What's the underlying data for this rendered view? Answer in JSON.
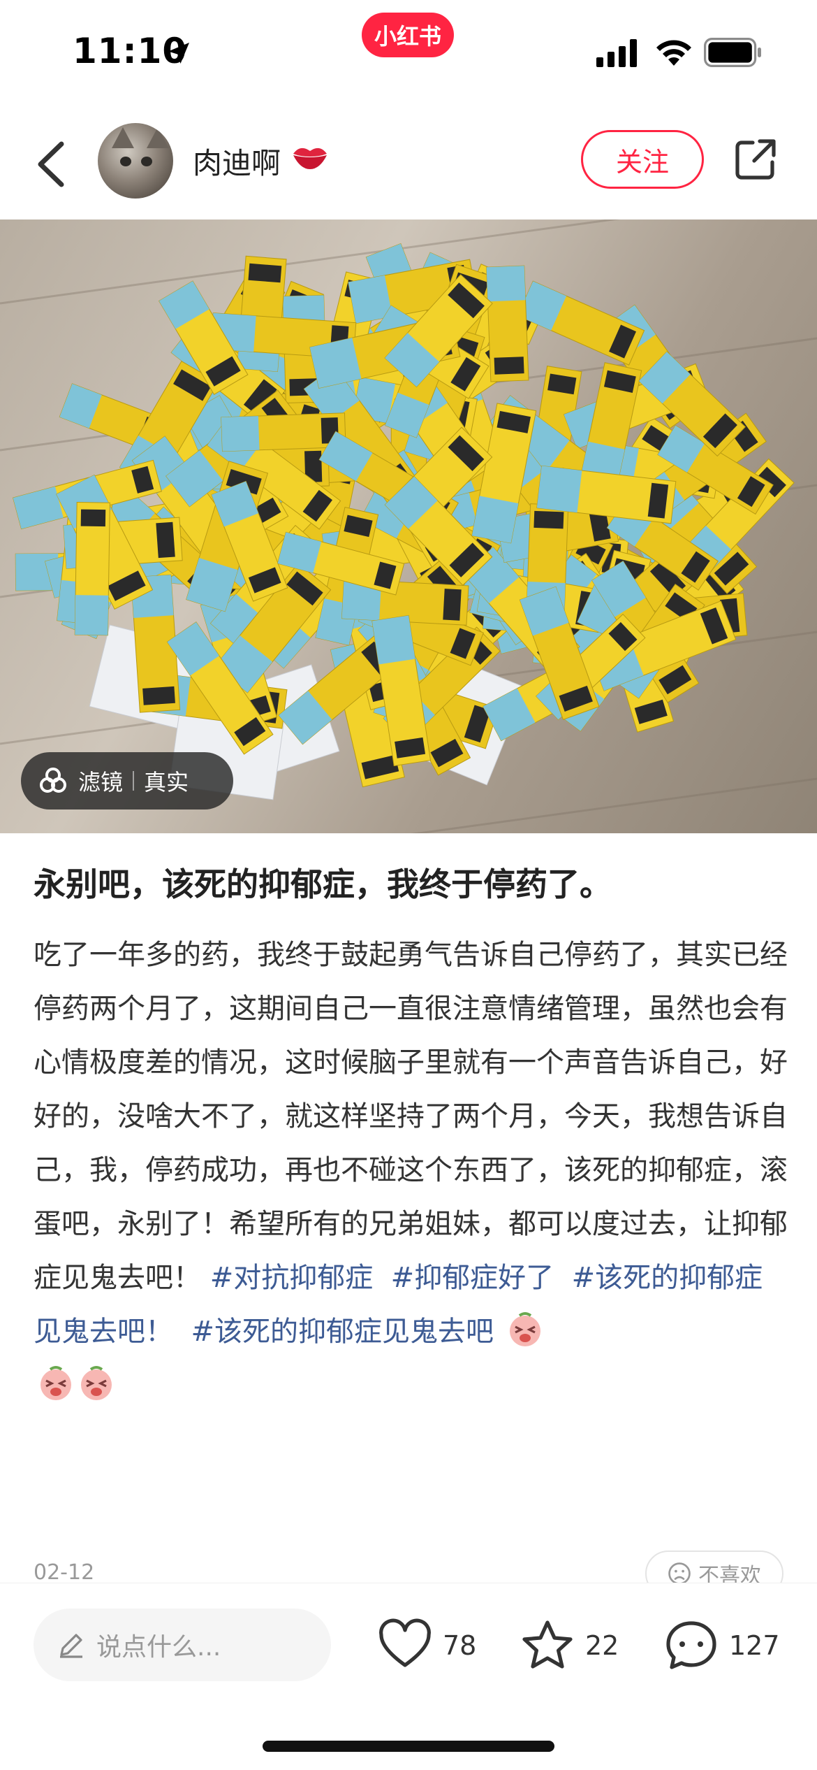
{
  "status": {
    "time": "11:10",
    "brand": "小红书"
  },
  "author": {
    "name": "肉迪啊",
    "follow_label": "关注"
  },
  "photo": {
    "filter_label": "滤镜",
    "filter_value": "真实"
  },
  "post": {
    "title": "永别吧，该死的抑郁症，我终于停药了。",
    "body": "吃了一年多的药，我终于鼓起勇气告诉自己停药了，其实已经停药两个月了，这期间自己一直很注意情绪管理，虽然也会有心情极度差的情况，这时候脑子里就有一个声音告诉自己，好好的，没啥大不了，就这样坚持了两个月，今天，我想告诉自己，我，停药成功，再也不碰这个东西了，该死的抑郁症，滚蛋吧，永别了！希望所有的兄弟姐妹，都可以度过去，让抑郁症见鬼去吧！",
    "tags": [
      "#对抗抑郁症",
      "#抑郁症好了",
      "#该死的抑郁症见鬼去吧！",
      "#该死的抑郁症见鬼去吧"
    ],
    "date": "02-12",
    "dislike_label": "不喜欢"
  },
  "bottom": {
    "comment_placeholder": "说点什么...",
    "likes": "78",
    "collects": "22",
    "comments": "127"
  },
  "colors": {
    "brand": "#ff2442",
    "tag": "#3d5b94"
  },
  "icons": [
    "location-arrow-icon",
    "signal-icon",
    "wifi-icon",
    "battery-icon",
    "back-arrow-icon",
    "lips-icon",
    "share-icon",
    "filter-icon",
    "emoji-icon",
    "dislike-face-icon",
    "pencil-icon",
    "heart-icon",
    "star-icon",
    "comment-bubble-icon"
  ]
}
